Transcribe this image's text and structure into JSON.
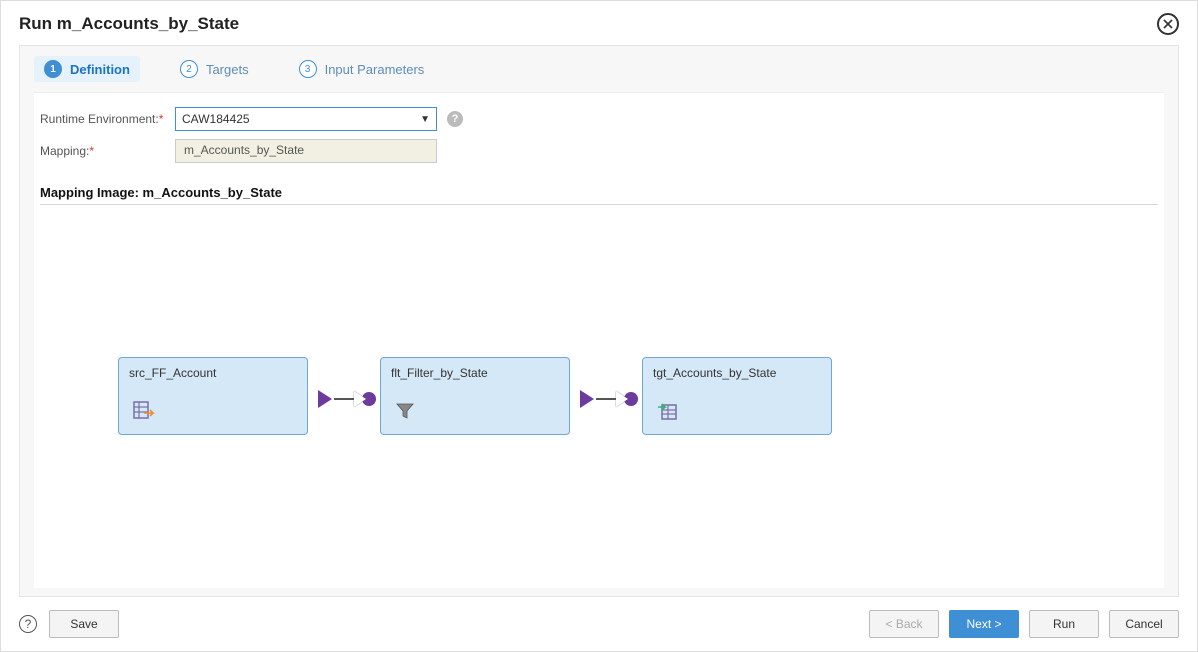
{
  "header": {
    "title": "Run m_Accounts_by_State"
  },
  "tabs": [
    {
      "num": "1",
      "label": "Definition",
      "active": true
    },
    {
      "num": "2",
      "label": "Targets",
      "active": false
    },
    {
      "num": "3",
      "label": "Input Parameters",
      "active": false
    }
  ],
  "form": {
    "runtime_env_label": "Runtime Environment:",
    "runtime_env_value": "CAW184425",
    "mapping_label": "Mapping:",
    "mapping_value": "m_Accounts_by_State"
  },
  "section": {
    "mapping_image_label": "Mapping Image:  m_Accounts_by_State"
  },
  "nodes": {
    "source": "src_FF_Account",
    "filter": "flt_Filter_by_State",
    "target": "tgt_Accounts_by_State"
  },
  "footer": {
    "save": "Save",
    "back": "< Back",
    "next": "Next >",
    "run": "Run",
    "cancel": "Cancel"
  }
}
